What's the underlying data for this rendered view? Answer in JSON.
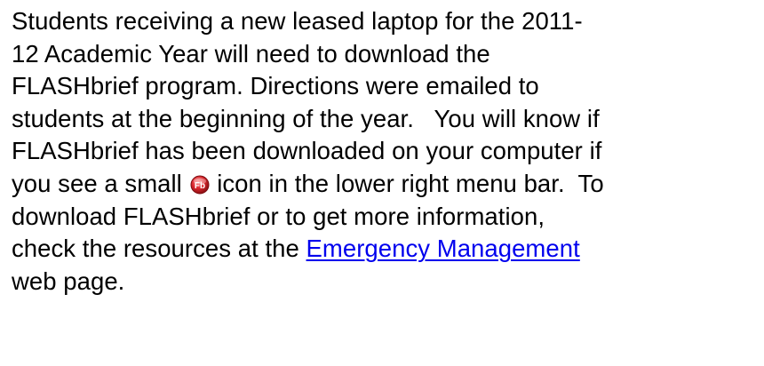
{
  "paragraph": {
    "lines": [
      "Students receiving a new leased laptop for the 2011-",
      "12 Academic Year will need to download the",
      "FLASHbrief program. Directions were emailed to",
      "students at the beginning of the year.   You will know if",
      "FLASHbrief has been downloaded on your computer if",
      "you see a small ",
      " icon in the lower right menu bar.  To",
      "download FLASHbrief or to get more information,",
      "check the resources at the ",
      "web page."
    ],
    "link_text": "Emergency Management",
    "icon_label": "Fb"
  },
  "colors": {
    "text": "#000000",
    "link": "#0000ee",
    "icon_fill": "#d9262c"
  },
  "icons": {
    "flashbrief": "flashbrief-logo-icon"
  }
}
